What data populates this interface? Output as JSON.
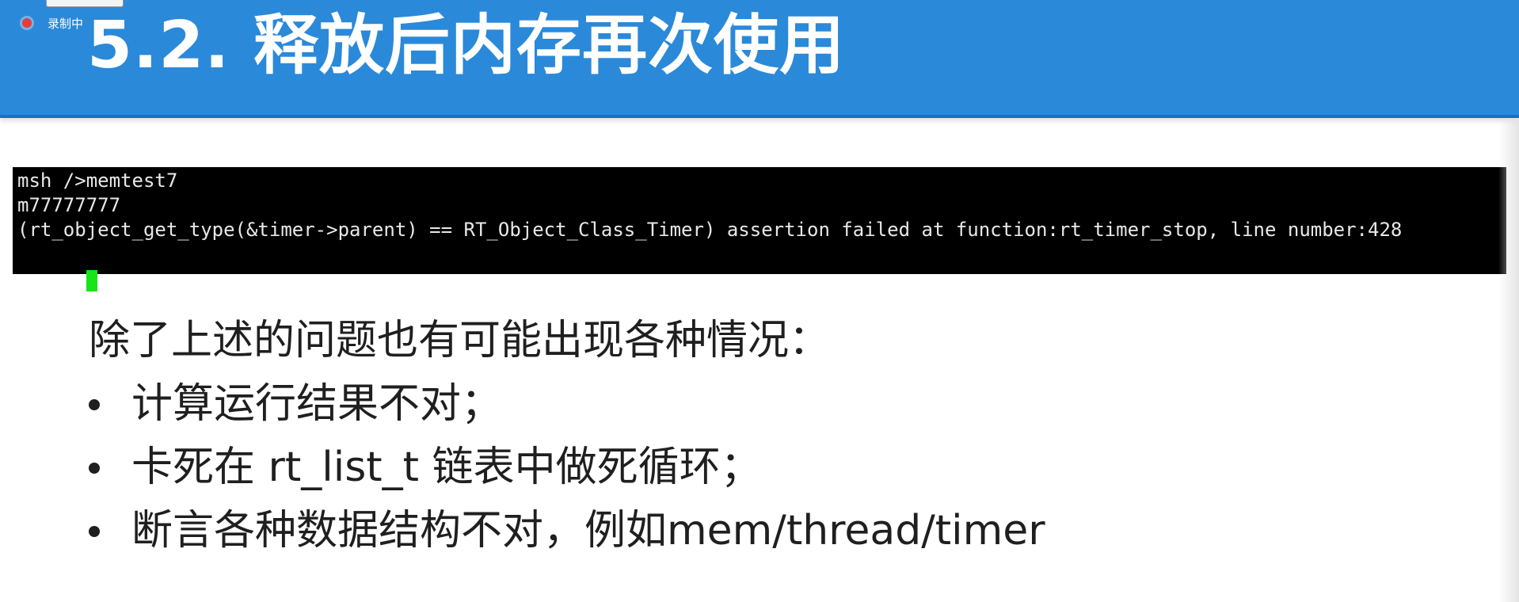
{
  "recording": {
    "label": "录制中"
  },
  "header": {
    "title": "5.2. 释放后内存再次使用"
  },
  "terminal": {
    "lines": [
      "msh />memtest7",
      "m77777777",
      "(rt_object_get_type(&timer->parent) == RT_Object_Class_Timer) assertion failed at function:rt_timer_stop, line number:428"
    ]
  },
  "content": {
    "intro": "除了上述的问题也有可能出现各种情况：",
    "bullets": [
      "计算运行结果不对；",
      "卡死在 rt_list_t 链表中做死循环；",
      "断言各种数据结构不对，例如mem/thread/timer"
    ]
  },
  "colors": {
    "header_bg": "#2a89d9",
    "terminal_bg": "#000000",
    "cursor": "#17e51a",
    "record_dot": "#e43b3b"
  }
}
